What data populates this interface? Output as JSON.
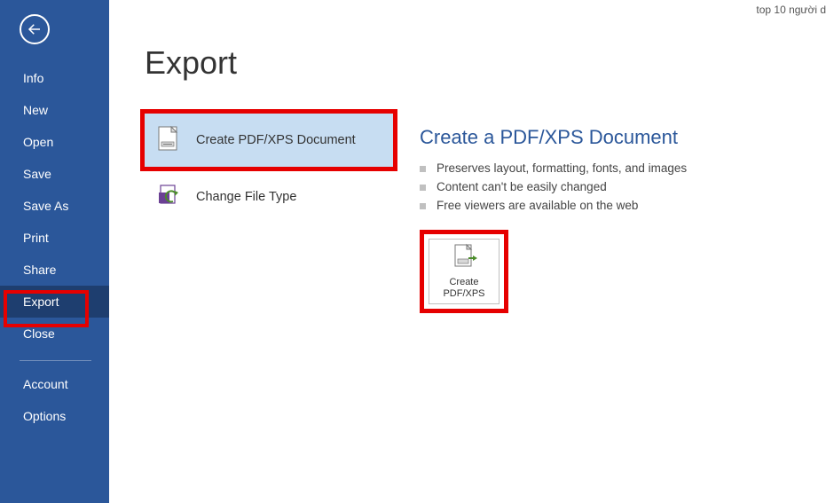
{
  "topText": "top 10 người d",
  "sidebar": {
    "items": [
      {
        "label": "Info"
      },
      {
        "label": "New"
      },
      {
        "label": "Open"
      },
      {
        "label": "Save"
      },
      {
        "label": "Save As"
      },
      {
        "label": "Print"
      },
      {
        "label": "Share"
      },
      {
        "label": "Export"
      },
      {
        "label": "Close"
      }
    ],
    "footer": [
      {
        "label": "Account"
      },
      {
        "label": "Options"
      }
    ]
  },
  "main": {
    "title": "Export",
    "options": [
      {
        "label": "Create PDF/XPS Document"
      },
      {
        "label": "Change File Type"
      }
    ],
    "detail": {
      "title": "Create a PDF/XPS Document",
      "bullets": [
        "Preserves layout, formatting, fonts, and images",
        "Content can't be easily changed",
        "Free viewers are available on the web"
      ],
      "buttonLine1": "Create",
      "buttonLine2": "PDF/XPS"
    }
  }
}
